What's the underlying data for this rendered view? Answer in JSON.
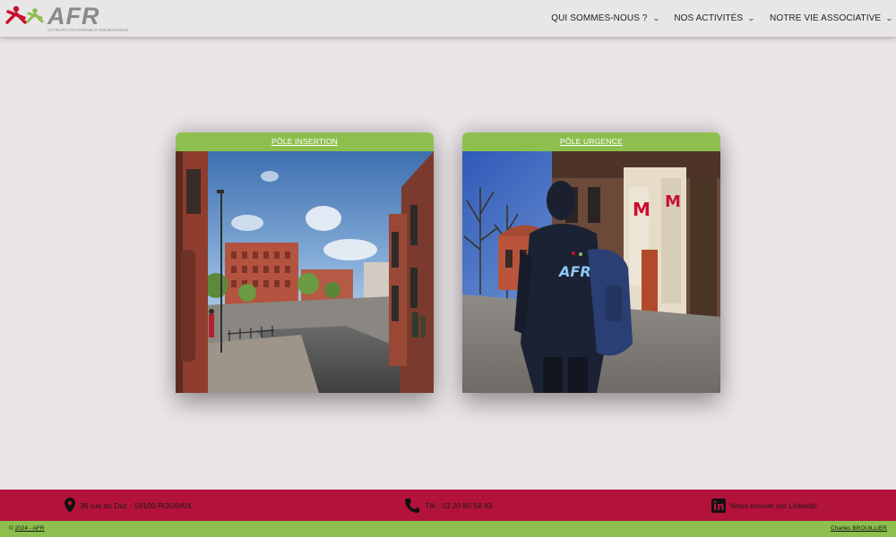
{
  "brand": {
    "name": "AFR",
    "tagline": "ACTEURS FRATERNELS ROUBAISIENS",
    "colors": {
      "red": "#c8102e",
      "green": "#8cbf4e",
      "grey": "#8a8a8a"
    }
  },
  "nav": {
    "items": [
      {
        "label": "QUI SOMMES-NOUS ?",
        "icon": "chevron-down-icon"
      },
      {
        "label": "NOS ACTIVITÉS",
        "icon": "chevron-down-icon"
      },
      {
        "label": "NOTRE VIE ASSOCIATIVE",
        "icon": "chevron-down-icon"
      }
    ]
  },
  "cards": [
    {
      "title": "PÔLE INSERTION",
      "image": "street-scene-photo"
    },
    {
      "title": "PÔLE URGENCE",
      "image": "person-with-backpack-photo"
    }
  ],
  "footer": {
    "address": "36 rue du Duc - 59100 ROUBAIX",
    "phone": "Tél : 03 20 80 58 83",
    "linkedin": "Nous trouver sur Linkedin",
    "background": "#b3133a"
  },
  "bottom": {
    "copyright_symbol": "©",
    "copyright_link": "2024 - AFR",
    "credit": "Charles BROUILLIER"
  }
}
